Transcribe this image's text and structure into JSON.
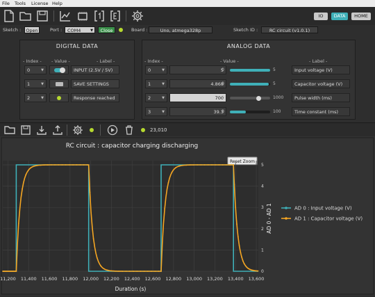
{
  "menu": [
    "File",
    "Tools",
    "License",
    "Help"
  ],
  "toolbar": {
    "icons": [
      "new-file-icon",
      "open-folder-icon",
      "save-icon",
      "chart-icon",
      "microchip-icon",
      "bracket-icon",
      "e-bracket-icon",
      "gear-icon"
    ],
    "view_buttons": [
      "IO",
      "DATA",
      "HOME"
    ],
    "active_view": "DATA"
  },
  "sketchbar": {
    "sketch_label": "Sketch :",
    "open_label": "Open",
    "port_label": "Port :",
    "port_value": "COM4",
    "close_label": "Close",
    "board_label": "Board :",
    "board_value": "Uno, atmega328p",
    "sketch_id_label": "Sketch ID :",
    "sketch_id_value": "RC circuit  (v1.0.1)"
  },
  "digital": {
    "title": "DIGITAL DATA",
    "headers": {
      "index": "- Index -",
      "value": "- Value -",
      "label": "- Label -"
    },
    "rows": [
      {
        "index": "0",
        "label": "INPUT (2.5V / 5V)",
        "kind": "toggle",
        "state": "on"
      },
      {
        "index": "1",
        "label": "SAVE SETTINGS",
        "kind": "button",
        "state": "off"
      },
      {
        "index": "2",
        "label": "Response reached",
        "kind": "led",
        "state": "on"
      }
    ]
  },
  "analog": {
    "title": "ANALOG DATA",
    "headers": {
      "index": "- Index -",
      "value": "- Value -",
      "label": "- Label -"
    },
    "rows": [
      {
        "index": "0",
        "value": "5",
        "min": "0",
        "max": "5",
        "level": 1.0,
        "label": "Input voltage (V)"
      },
      {
        "index": "1",
        "value": "4.868",
        "min": "0",
        "max": "5",
        "level": 0.97,
        "label": "Capacitor voltage (V)"
      },
      {
        "index": "2",
        "value": "700",
        "min": "0",
        "max": "1000",
        "level": 0.7,
        "label": "Pulse width (ms)",
        "editable": true
      },
      {
        "index": "3",
        "value": "39.3",
        "min": "0",
        "max": "100",
        "level": 0.39,
        "label": "Time constant (ms)"
      }
    ]
  },
  "plot_toolbar": {
    "icons": [
      "folder-icon",
      "save-icon",
      "download-icon",
      "upload-icon",
      "gear-icon",
      "play-icon",
      "trash-icon"
    ],
    "counter": "23,010"
  },
  "colors": {
    "input": "#3fb0b8",
    "capacitor": "#f5a623",
    "status_green": "#b6d92f"
  },
  "chart_data": {
    "type": "line",
    "title": "RC circuit : capacitor charging discharging",
    "xlabel": "Duration (s)",
    "ylabel": "AD 0 - AD 1",
    "reset_label": "Reset Zoom",
    "xlim": [
      11.15,
      13.62
    ],
    "ylim": [
      0,
      5
    ],
    "x_ticks": [
      "11,200",
      "11,400",
      "11,600",
      "11,800",
      "12,000",
      "12,200",
      "12,400",
      "12,600",
      "12,800",
      "13,000",
      "13,200",
      "13,400",
      "13,600"
    ],
    "x_tick_values": [
      11.2,
      11.4,
      11.6,
      11.8,
      12.0,
      12.2,
      12.4,
      12.6,
      12.8,
      13.0,
      13.2,
      13.4,
      13.6
    ],
    "y_ticks": [
      "0",
      "1",
      "2",
      "3",
      "4",
      "5"
    ],
    "tau": 0.0393,
    "series": [
      {
        "name": "AD 0 : Input voltage (V)",
        "color": "#3fb0b8",
        "x": [
          11.15,
          11.28,
          11.28,
          11.98,
          11.98,
          12.68,
          12.68,
          13.38,
          13.38,
          13.62
        ],
        "values": [
          0,
          0,
          5,
          5,
          0,
          0,
          5,
          5,
          0,
          0
        ]
      },
      {
        "name": "AD 1 : Capacitor voltage (V)",
        "color": "#f5a623",
        "edges": [
          11.28,
          11.98,
          12.68,
          13.38
        ],
        "levels": [
          0,
          5,
          0,
          5,
          0
        ]
      }
    ],
    "legend_position": "right",
    "grid": true
  }
}
